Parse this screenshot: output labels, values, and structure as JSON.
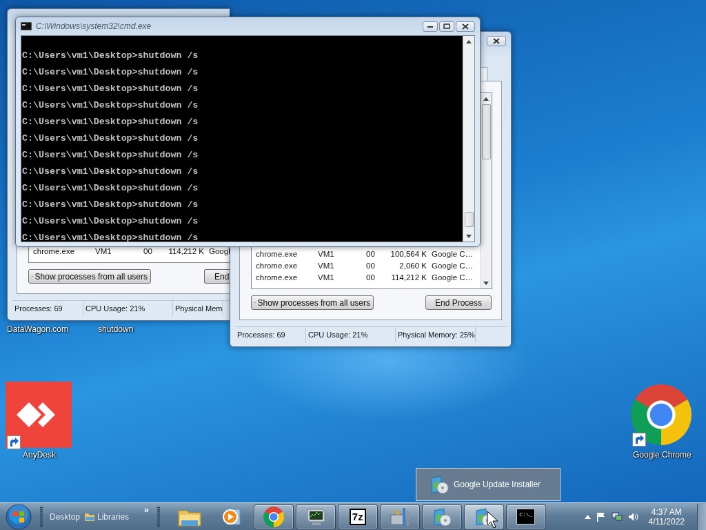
{
  "task_manager_back": {
    "rows": [
      {
        "name": "chrome.exe",
        "user": "VM1",
        "cpu": "00",
        "memory": "114,212 K",
        "description": "Googl"
      }
    ],
    "buttons": [
      "Show processes from all users",
      "End"
    ],
    "status": [
      "Processes: 69",
      "CPU Usage: 21%",
      "Physical Mem"
    ]
  },
  "task_manager_front": {
    "rows": [
      {
        "name": "chrome.exe",
        "user": "VM1",
        "cpu": "00",
        "memory": "100,564 K",
        "description": "Google C…"
      },
      {
        "name": "chrome.exe",
        "user": "VM1",
        "cpu": "00",
        "memory": "2,060 K",
        "description": "Google C…"
      },
      {
        "name": "chrome.exe",
        "user": "VM1",
        "cpu": "00",
        "memory": "114,212 K",
        "description": "Google C…"
      }
    ],
    "buttons": [
      "Show processes from all users",
      "End Process"
    ],
    "status": [
      "Processes: 69",
      "CPU Usage: 21%",
      "Physical Memory: 25%"
    ]
  },
  "cmd_window": {
    "title": "C:\\Windows\\system32\\cmd.exe",
    "lines": [
      "C:\\Users\\vm1\\Desktop>shutdown /s",
      "C:\\Users\\vm1\\Desktop>shutdown /s",
      "C:\\Users\\vm1\\Desktop>shutdown /s",
      "C:\\Users\\vm1\\Desktop>shutdown /s",
      "C:\\Users\\vm1\\Desktop>shutdown /s",
      "C:\\Users\\vm1\\Desktop>shutdown /s",
      "C:\\Users\\vm1\\Desktop>shutdown /s",
      "C:\\Users\\vm1\\Desktop>shutdown /s",
      "C:\\Users\\vm1\\Desktop>shutdown /s",
      "C:\\Users\\vm1\\Desktop>shutdown /s",
      "C:\\Users\\vm1\\Desktop>shutdown /s",
      "C:\\Users\\vm1\\Desktop>shutdown /s"
    ]
  },
  "desktop_icons": [
    {
      "kind": "label",
      "label": "DataWagon.com"
    },
    {
      "kind": "label",
      "label": "shutdown"
    },
    {
      "kind": "anydesk",
      "label": "AnyDesk"
    },
    {
      "kind": "chrome",
      "label": "Google Chrome"
    }
  ],
  "thumbnail_popup": {
    "title": "Google Update Installer"
  },
  "taskbar": {
    "toolbar": {
      "links": [
        "Desktop",
        "Libraries"
      ],
      "overflow": "»"
    },
    "buttons": [
      {
        "kind": "explorer",
        "running": false,
        "selected": false
      },
      {
        "kind": "media",
        "running": false,
        "selected": false
      },
      {
        "kind": "chrome",
        "running": true,
        "selected": false
      },
      {
        "kind": "monitor",
        "running": true,
        "selected": false
      },
      {
        "kind": "archive",
        "label": "7z",
        "running": true,
        "selected": false
      },
      {
        "kind": "tools",
        "running": true,
        "selected": false
      },
      {
        "kind": "installer",
        "running": true,
        "selected": false
      },
      {
        "kind": "installer",
        "running": true,
        "selected": true
      },
      {
        "kind": "cmd",
        "label": "C:\\_",
        "running": true,
        "selected": false
      }
    ],
    "clock": {
      "time": "4:37 AM",
      "date": "4/11/2022"
    }
  }
}
